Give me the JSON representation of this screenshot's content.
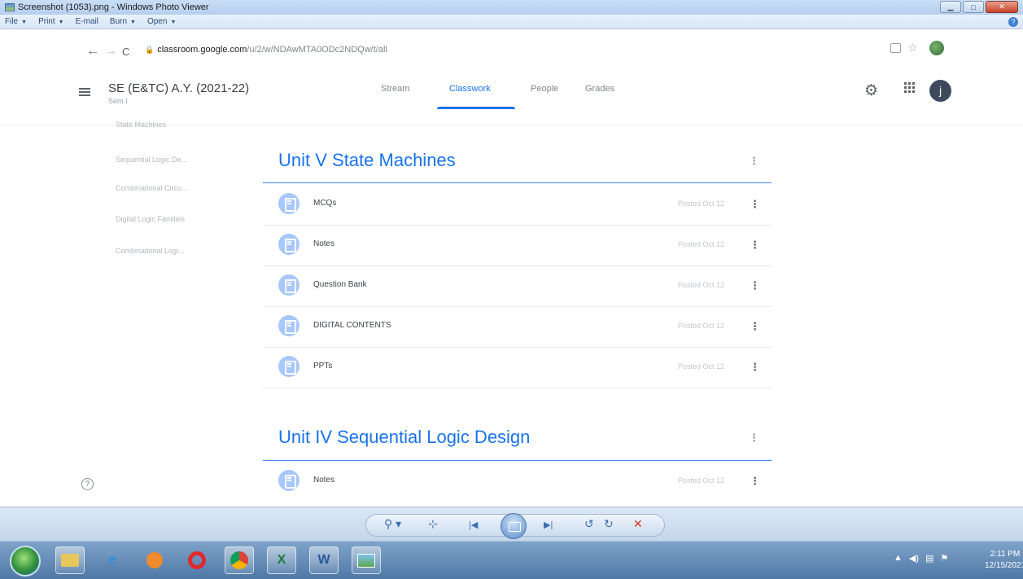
{
  "window": {
    "title": "Screenshot (1053).png - Windows Photo Viewer",
    "menu": [
      {
        "label": "File",
        "caret": "▼"
      },
      {
        "label": "Print",
        "caret": "▼"
      },
      {
        "label": "E-mail",
        "caret": ""
      },
      {
        "label": "Burn",
        "caret": "▼"
      },
      {
        "label": "Open",
        "caret": "▼"
      }
    ],
    "controls": {
      "minimize": "▁",
      "maximize": "□",
      "close": "✕"
    },
    "help": "?"
  },
  "browser": {
    "back": "←",
    "forward": "→",
    "reload": "C",
    "lock": "🔒",
    "url_host": "classroom.google.com",
    "url_path": "/u/2/w/NDAwMTA0ODc2NDQw/t/all",
    "star": "☆"
  },
  "classroom": {
    "class_title": "SE (E&TC) A.Y. (2021-22)",
    "class_subtitle": "Sem I",
    "tabs": [
      {
        "label": "Stream",
        "active": false
      },
      {
        "label": "Classwork",
        "active": true
      },
      {
        "label": "People",
        "active": false
      },
      {
        "label": "Grades",
        "active": false
      }
    ],
    "avatar_letter": "j",
    "accent_color": "#1a73e8"
  },
  "sidebar": {
    "topics": [
      {
        "label": "State Machines"
      },
      {
        "label": "Sequential Logic De..."
      },
      {
        "label": "Combinational Circu..."
      },
      {
        "label": "Digital Logic Families"
      },
      {
        "label": "Combinational Logi..."
      }
    ],
    "help_label": "?"
  },
  "sections": [
    {
      "title": "Unit V State Machines",
      "items": [
        {
          "label": "MCQs",
          "date": "Posted Oct 12"
        },
        {
          "label": "Notes",
          "date": "Posted Oct 12"
        },
        {
          "label": "Question Bank",
          "date": "Posted Oct 12"
        },
        {
          "label": "DIGITAL CONTENTS",
          "date": "Posted Oct 12"
        },
        {
          "label": "PPTs",
          "date": "Posted Oct 12"
        }
      ]
    },
    {
      "title": "Unit IV Sequential Logic Design",
      "items": [
        {
          "label": "Notes",
          "date": "Posted Oct 12"
        }
      ]
    }
  ],
  "kebab_glyph": "⋮",
  "viewer_toolbar": {
    "zoom": "⚲ ▾",
    "actual_size": "⊹",
    "previous": "|◀",
    "next": "▶|",
    "rotate_ccw": "↺",
    "rotate_cw": "↻",
    "delete": "✕"
  },
  "taskbar": {
    "clock_time": "2:11 PM",
    "clock_date": "12/15/2021",
    "tray": [
      "▲",
      "◀)",
      "▤",
      "⚑"
    ]
  }
}
